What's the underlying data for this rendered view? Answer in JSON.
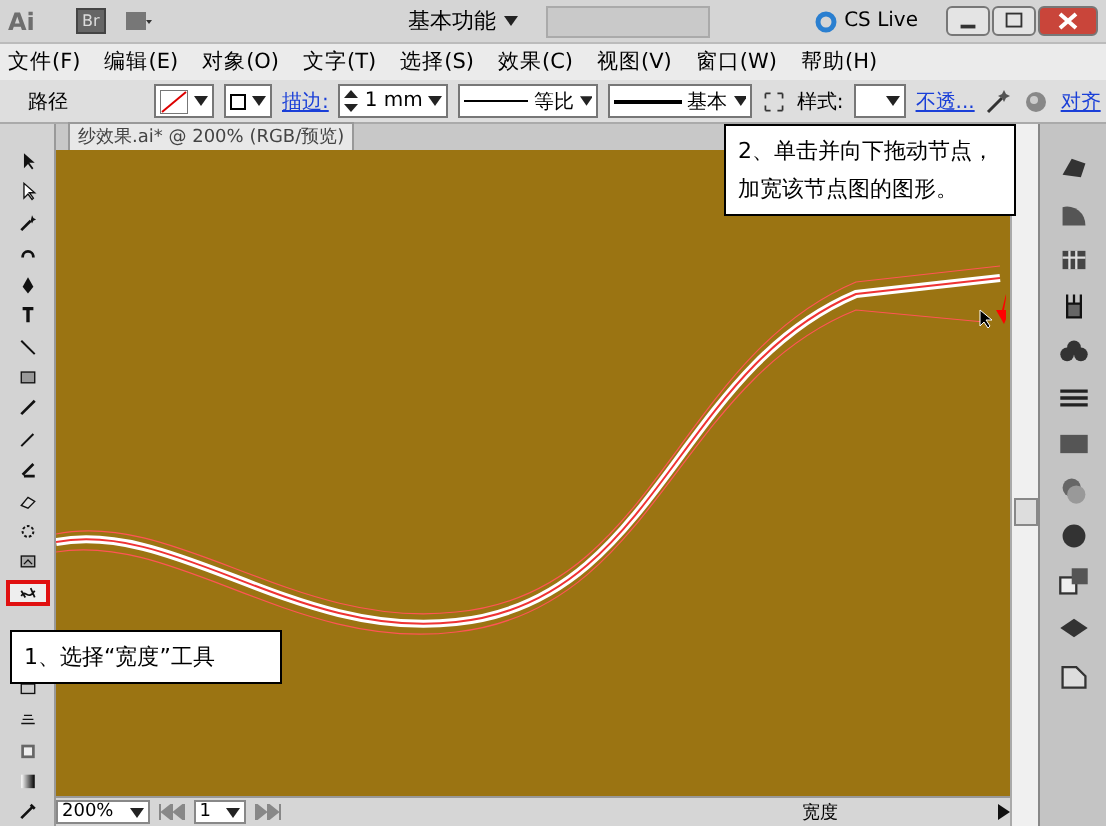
{
  "title_bar": {
    "logo": "Ai",
    "bridge": "Br",
    "workspace": "基本功能",
    "cs_live": "CS Live"
  },
  "menu": [
    "文件(F)",
    "编辑(E)",
    "对象(O)",
    "文字(T)",
    "选择(S)",
    "效果(C)",
    "视图(V)",
    "窗口(W)",
    "帮助(H)"
  ],
  "control_bar": {
    "object": "路径",
    "stroke_label": "描边:",
    "stroke_weight": "1 mm",
    "profile": "等比",
    "brush": "基本",
    "style_label": "样式:",
    "opacity": "不透...",
    "align": "对齐"
  },
  "document_tab": {
    "title": "纱效果.ai* @ 200% (RGB/预览)"
  },
  "tools": [
    {
      "selected": false
    },
    {
      "selected": false
    },
    {
      "selected": false
    },
    {
      "selected": false
    },
    {
      "selected": false
    },
    {
      "selected": false
    },
    {
      "selected": false
    },
    {
      "selected": false
    },
    {
      "selected": false
    },
    {
      "selected": false
    },
    {
      "selected": false
    },
    {
      "selected": false
    },
    {
      "selected": false
    },
    {
      "selected": false
    },
    {
      "selected": true
    },
    {
      "selected": false
    },
    {
      "selected": false
    },
    {
      "selected": false
    },
    {
      "selected": false
    },
    {
      "selected": false
    }
  ],
  "callouts": [
    {
      "text": "2、单击并向下拖动节点，加宽该节点图的图形。"
    },
    {
      "text": "1、选择“宽度”工具"
    }
  ],
  "status_bar": {
    "zoom": "200%",
    "artboard": "1",
    "current_tool": "宽度"
  }
}
